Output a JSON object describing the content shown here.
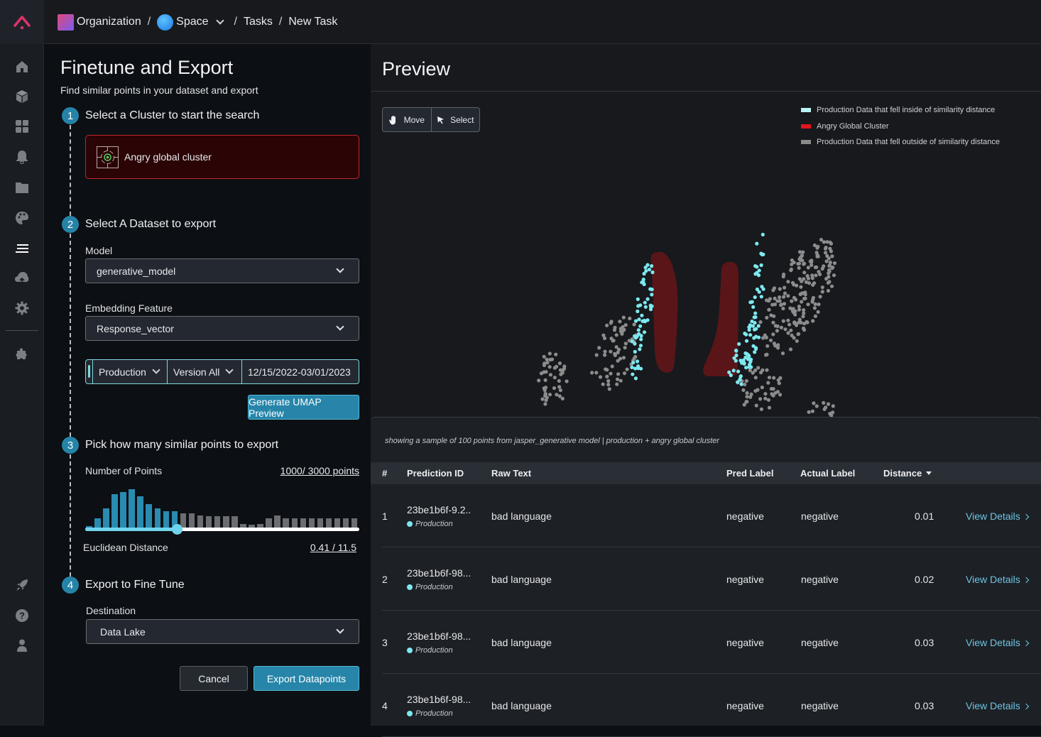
{
  "app": {
    "logo_icon": "arize-caret-logo-icon",
    "brand_color": "#e0336a"
  },
  "breadcrumb": {
    "organization": "Organization",
    "space": "Space",
    "tasks": "Tasks",
    "current": "New Task",
    "separator": "/"
  },
  "sidebar": {
    "items": [
      {
        "icon": "home-icon",
        "label": "Home"
      },
      {
        "icon": "cube-icon",
        "label": "Models"
      },
      {
        "icon": "grid-icon",
        "label": "Dashboards"
      },
      {
        "icon": "bell-icon",
        "label": "Monitors"
      },
      {
        "icon": "folder-icon",
        "label": "Datasets"
      },
      {
        "icon": "palette-icon",
        "label": "Themes"
      },
      {
        "icon": "list-icon",
        "label": "Tasks",
        "active": true
      },
      {
        "icon": "cloud-upload-icon",
        "label": "Upload"
      },
      {
        "icon": "gear-icon",
        "label": "Settings"
      },
      {
        "icon": "puzzle-icon",
        "label": "Integrations"
      }
    ],
    "bottom_items": [
      {
        "icon": "rocket-icon",
        "label": "Getting Started"
      },
      {
        "icon": "help-icon",
        "label": "Help"
      },
      {
        "icon": "user-icon",
        "label": "Profile"
      }
    ]
  },
  "form": {
    "title": "Finetune and Export",
    "subtitle": "Find similar points in your dataset and export",
    "steps": [
      {
        "num": "1",
        "title": "Select a Cluster to start the search"
      },
      {
        "num": "2",
        "title": "Select A Dataset to export"
      },
      {
        "num": "3",
        "title": "Pick how many similar points to export"
      },
      {
        "num": "4",
        "title": "Export to Fine Tune"
      }
    ],
    "cluster": {
      "label": "Angry global cluster",
      "icon": "cluster-target-icon"
    },
    "model": {
      "label": "Model",
      "value": "generative_model"
    },
    "embedding": {
      "label": "Embedding Feature",
      "value": "Response_vector"
    },
    "filters": {
      "environment": "Production",
      "version": "Version All",
      "date_range": "12/15/2022-03/01/2023"
    },
    "generate_button": "Generate UMAP Preview",
    "points": {
      "label": "Number of Points",
      "value": "1000/ 3000 points",
      "distance_label": "Euclidean Distance",
      "distance_value": "0.41 / 11.5",
      "slider_fraction": 0.333,
      "histogram_selected": [
        3,
        10,
        20,
        33,
        35,
        38,
        31,
        24,
        20,
        17,
        17
      ],
      "histogram_unselected": [
        15,
        15,
        13,
        12,
        12,
        12,
        12,
        5,
        4,
        5,
        10,
        13,
        10,
        10,
        10,
        10,
        10,
        10,
        10,
        10,
        10
      ]
    },
    "destination": {
      "label": "Destination",
      "value": "Data Lake"
    },
    "cancel_button": "Cancel",
    "export_button": "Export Datapoints"
  },
  "preview": {
    "title": "Preview",
    "tools": [
      {
        "icon": "hand-icon",
        "label": "Move"
      },
      {
        "icon": "cursor-icon",
        "label": "Select"
      }
    ],
    "legend": [
      {
        "label": "Production Data that fell inside of similarity distance",
        "color": "#7ce9ef"
      },
      {
        "label": "Angry Global Cluster",
        "color": "#e0141c"
      },
      {
        "label": "Production Data that fell outside of similarity distance",
        "color": "#8a8a8a"
      }
    ],
    "colors": {
      "inside": "#7ce9ef",
      "cluster": "#5a1518",
      "outside": "#8c8c8c"
    },
    "caption": "showing a sample of 100 points from jasper_generative model | production + angry global cluster",
    "table": {
      "columns": [
        "#",
        "Prediction ID",
        "Raw Text",
        "Pred Label",
        "Actual Label",
        "Distance"
      ],
      "sort_column": "Distance",
      "link_label": "View Details",
      "rows": [
        {
          "idx": "1",
          "pid": "23be1b6f-9.2..",
          "env": "Production",
          "raw": "bad language",
          "pred": "negative",
          "actual": "negative",
          "dist": "0.01"
        },
        {
          "idx": "2",
          "pid": "23be1b6f-98...",
          "env": "Production",
          "raw": "bad language",
          "pred": "negative",
          "actual": "negative",
          "dist": "0.02"
        },
        {
          "idx": "3",
          "pid": "23be1b6f-98...",
          "env": "Production",
          "raw": "bad language",
          "pred": "negative",
          "actual": "negative",
          "dist": "0.03"
        },
        {
          "idx": "4",
          "pid": "23be1b6f-98...",
          "env": "Production",
          "raw": "bad language",
          "pred": "negative",
          "actual": "negative",
          "dist": "0.03"
        }
      ]
    }
  }
}
